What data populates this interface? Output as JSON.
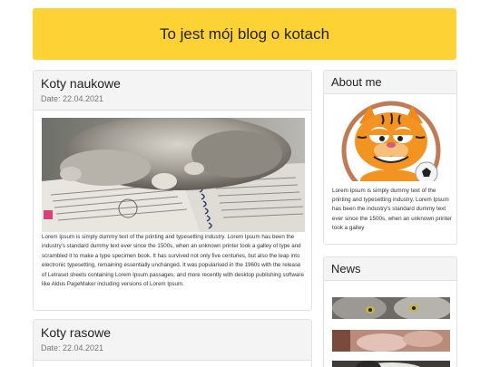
{
  "header": {
    "title": "To jest mój blog o kotach"
  },
  "posts": [
    {
      "title": "Koty naukowe",
      "date": "Date: 22.04.2021",
      "image_alt": "kot-na-ksiazce",
      "text": "Lorem Ipsum is simply dummy text of the printing and typesetting industry. Lorem Ipsum has been the industry's standard dummy text ever since the 1500s, when an unknown printer took a galley of type and scrambled it to make a type specimen book. It has survived not only five centuries, but also the leap into electronic typesetting, remaining essentially unchanged. It was popularised in the 1960s with the release of Letraset sheets containing Lorem Ipsum passages, and more recently with desktop publishing software like Aldus PageMaker including versions of Lorem Ipsum."
    },
    {
      "title": "Koty rasowe",
      "date": "Date: 22.04.2021"
    }
  ],
  "sidebar": {
    "about": {
      "title": "About me",
      "avatar_icon": "cartoon-cat-icon",
      "text": "Lorem Ipsum is simply dummy text of the printing and typesetting industry. Lorem Ipsum has been the industry's standard dummy text ever since the 1500s, when an unknown printer took a galley"
    },
    "news": {
      "title": "News",
      "thumbnails": [
        "cat-photo-1",
        "cat-photo-2",
        "cat-photo-3"
      ]
    }
  },
  "colors": {
    "header_bg": "#fdd235",
    "card_head_bg": "#f4f4f4",
    "border": "#e2e2e2"
  }
}
